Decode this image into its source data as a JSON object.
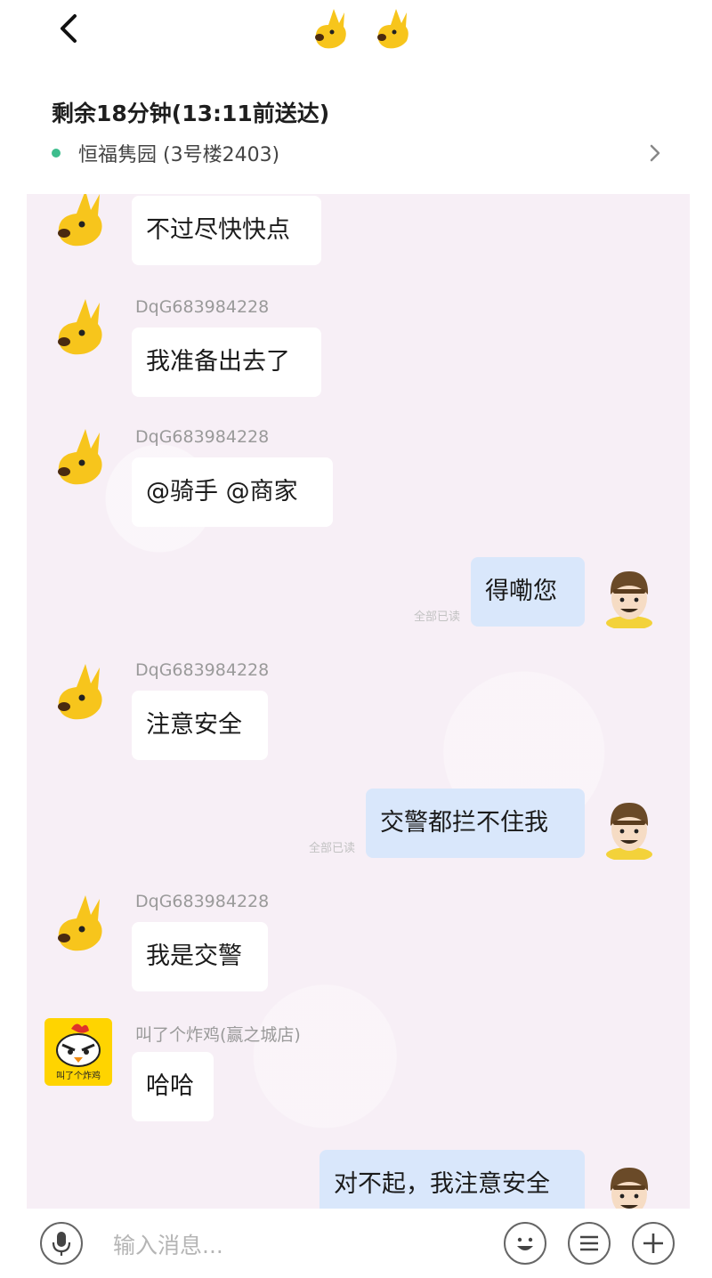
{
  "order": {
    "title": "剩余18分钟(13:11前送达)",
    "address": "恒福隽园 (3号楼2403)"
  },
  "messages": [
    {
      "side": "left",
      "avatar": "kangaroo-avatar",
      "sender": "",
      "text": "不过尽快快点"
    },
    {
      "side": "left",
      "avatar": "kangaroo-avatar",
      "sender": "DqG683984228",
      "text": "我准备出去了"
    },
    {
      "side": "left",
      "avatar": "kangaroo-avatar",
      "sender": "DqG683984228",
      "text": "@骑手 @商家"
    },
    {
      "side": "right",
      "avatar": "rider-avatar",
      "text": "得嘞您",
      "read": "全部已读"
    },
    {
      "side": "left",
      "avatar": "kangaroo-avatar",
      "sender": "DqG683984228",
      "text": "注意安全"
    },
    {
      "side": "right",
      "avatar": "rider-avatar",
      "text": "交警都拦不住我",
      "read": "全部已读"
    },
    {
      "side": "left",
      "avatar": "kangaroo-avatar",
      "sender": "DqG683984228",
      "text": "我是交警"
    },
    {
      "side": "left",
      "avatar": "chicken-shop-avatar",
      "sender": "叫了个炸鸡(赢之城店)",
      "text": "哈哈",
      "avatar_text": "叫了个炸鸡"
    },
    {
      "side": "right",
      "avatar": "rider-avatar",
      "text": "对不起，我注意安全"
    }
  ],
  "input": {
    "placeholder": "输入消息..."
  },
  "icons": {
    "back": "back-chevron-icon",
    "voice": "microphone-icon",
    "emoji": "emoji-icon",
    "quick": "quick-reply-icon",
    "plus": "plus-icon"
  },
  "colors": {
    "chat_bg": "#f7eff6",
    "left_bubble": "#ffffff",
    "right_bubble": "#d9e7fb",
    "status_dot": "#3dbd8d",
    "kangaroo": "#f7c51c"
  }
}
